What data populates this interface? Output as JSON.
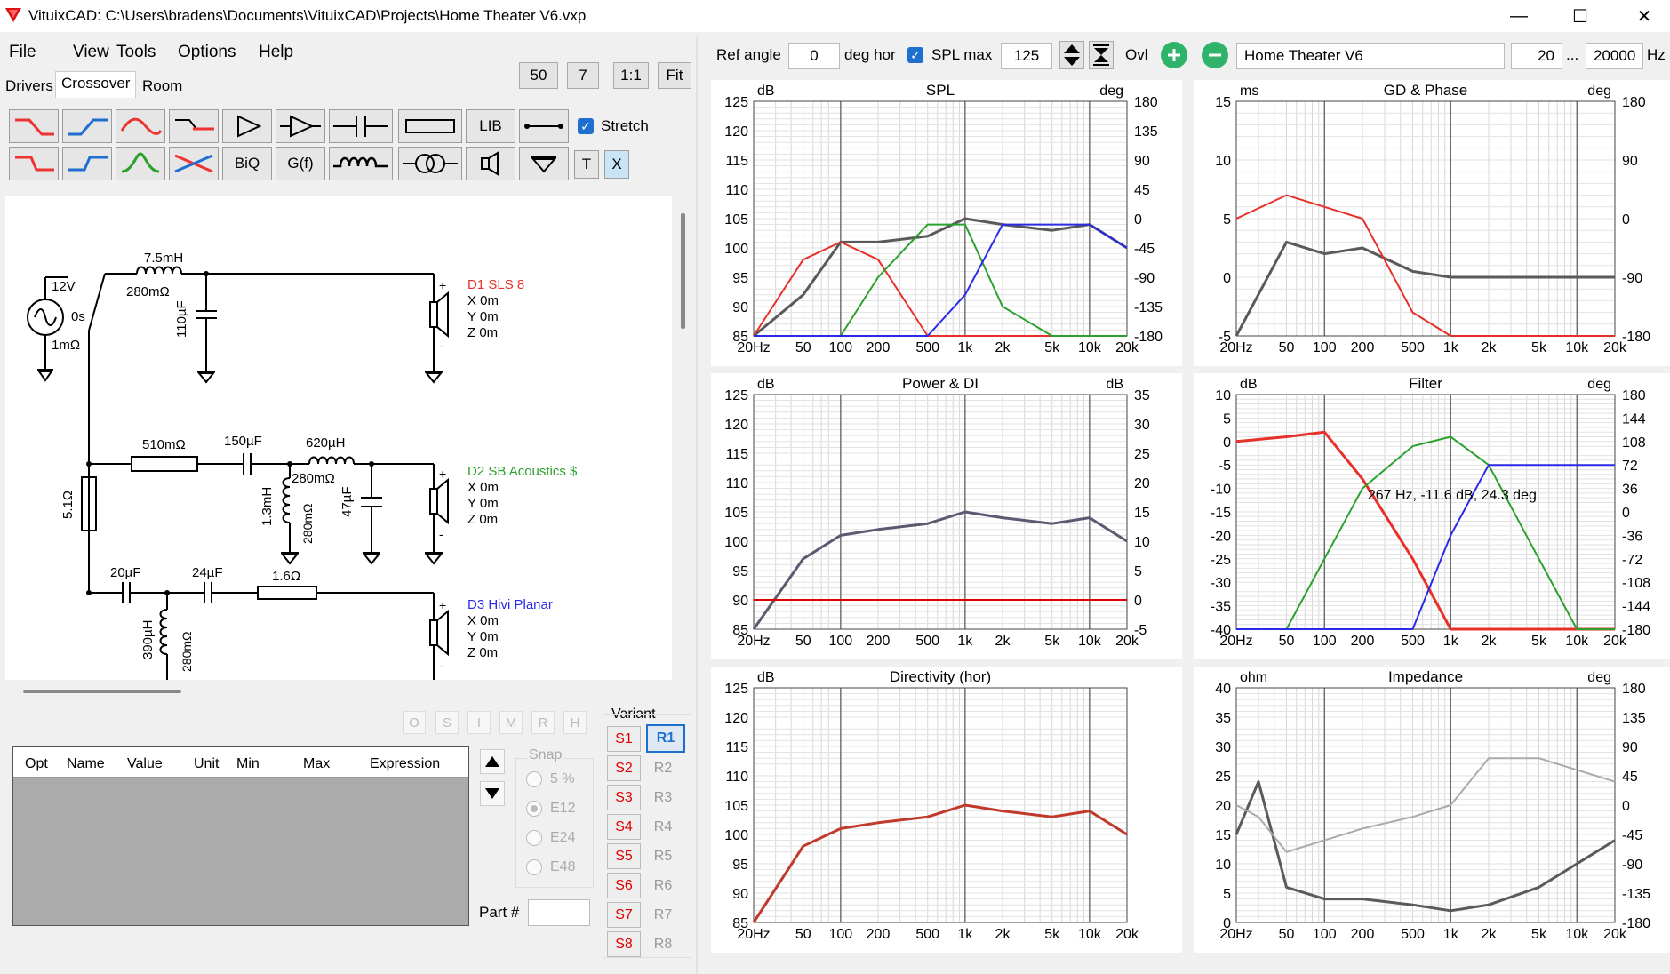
{
  "window": {
    "title": "VituixCAD: C:\\Users\\bradens\\Documents\\VituixCAD\\Projects\\Home Theater V6.vxp",
    "minimize": "—",
    "maximize": "☐",
    "close": "✕"
  },
  "menu": [
    "File",
    "View",
    "Tools",
    "Options",
    "Help"
  ],
  "tabs": [
    "Drivers",
    "Crossover",
    "Room"
  ],
  "zoom": {
    "b50": "50",
    "b7": "7",
    "b11": "1:1",
    "fit": "Fit"
  },
  "toolbar": {
    "lib": "LIB",
    "biq": "BiQ",
    "gf": "G(f)",
    "t": "T",
    "x": "X",
    "stretch": "Stretch"
  },
  "top": {
    "ref_angle_label": "Ref angle",
    "ref_angle": "0",
    "deg_hor": "deg hor",
    "spl_max_label": "SPL max",
    "spl_max": "125",
    "ovl": "Ovl",
    "name": "Home Theater V6",
    "f_lo": "20",
    "dots": "...",
    "f_hi": "20000",
    "hz": "Hz"
  },
  "schematic": {
    "source": {
      "v": "12V",
      "t": "0s",
      "r": "1mΩ"
    },
    "b1": {
      "l": "7.5mH",
      "lr": "280mΩ",
      "c": "110µF"
    },
    "d1": {
      "name": "D1 SLS 8",
      "x": "X 0m",
      "y": "Y 0m",
      "z": "Z 0m"
    },
    "b2": {
      "r": "510mΩ",
      "c": "150µF",
      "l": "620µH",
      "lr": "280mΩ",
      "sl": "1.3mH",
      "slr": "280mΩ",
      "sc": "47µF",
      "rs": "5.1Ω"
    },
    "d2": {
      "name": "D2 SB Acoustics $",
      "x": "X 0m",
      "y": "Y 0m",
      "z": "Z 0m"
    },
    "b3": {
      "c1": "20µF",
      "c2": "24µF",
      "r": "1.6Ω",
      "l": "390µH",
      "lr": "280mΩ"
    },
    "d3": {
      "name": "D3 Hivi Planar",
      "x": "X 0m",
      "y": "Y 0m",
      "z": "Z 0m"
    }
  },
  "opt_buttons": [
    "O",
    "S",
    "I",
    "M",
    "R",
    "H"
  ],
  "table": {
    "headers": [
      "Opt",
      "Name",
      "Value",
      "Unit",
      "Min",
      "Max",
      "Expression"
    ]
  },
  "snap": {
    "label": "Snap",
    "options": [
      "5 %",
      "E12",
      "E24",
      "E48"
    ],
    "selected": "E12"
  },
  "part": {
    "label": "Part #"
  },
  "variant": {
    "label": "Variant",
    "s": [
      "S1",
      "S2",
      "S3",
      "S4",
      "S5",
      "S6",
      "S7",
      "S8"
    ],
    "r": [
      "R1",
      "R2",
      "R3",
      "R4",
      "R5",
      "R6",
      "R7",
      "R8"
    ],
    "active": "R1"
  },
  "colors": {
    "d1": "#e8302a",
    "d2": "#2ca02c",
    "d3": "#2a2ae8",
    "total": "#5a5a5a",
    "power": "#5a5a70",
    "di": "#e00000",
    "directivity": "#c0392b"
  },
  "x_ticks": [
    "20Hz",
    "50",
    "100",
    "200",
    "500",
    "1k",
    "2k",
    "5k",
    "10k",
    "20k"
  ],
  "chart_data": [
    {
      "type": "line",
      "title": "SPL",
      "ylabel": "dB",
      "y2label": "deg",
      "ylim": [
        85,
        125
      ],
      "y2lim": [
        -180,
        180
      ],
      "yticks": [
        "125",
        "120",
        "115",
        "110",
        "105",
        "100",
        "95",
        "90",
        "85"
      ],
      "y2ticks": [
        "180",
        "135",
        "90",
        "45",
        "0",
        "-45",
        "-90",
        "-135",
        "-180"
      ],
      "x": [
        20,
        50,
        100,
        200,
        500,
        1000,
        2000,
        5000,
        10000,
        20000
      ],
      "series": [
        {
          "values": [
            85,
            92,
            101,
            101,
            102,
            105,
            104,
            103,
            104,
            100
          ]
        },
        {
          "values": [
            85,
            98,
            101,
            98,
            85,
            85,
            85,
            85,
            85,
            85
          ]
        },
        {
          "values": [
            85,
            85,
            85,
            95,
            104,
            104,
            90,
            85,
            85,
            85
          ]
        },
        {
          "values": [
            85,
            85,
            85,
            85,
            85,
            92,
            104,
            104,
            104,
            100
          ]
        }
      ]
    },
    {
      "type": "line",
      "title": "GD & Phase",
      "ylabel": "ms",
      "y2label": "deg",
      "ylim": [
        -5,
        15
      ],
      "y2lim": [
        -180,
        180
      ],
      "yticks": [
        "15",
        "10",
        "5",
        "0",
        "-5"
      ],
      "y2ticks": [
        "180",
        "90",
        "0",
        "-90",
        "-180"
      ],
      "x": [
        20,
        50,
        100,
        200,
        500,
        1000,
        2000,
        5000,
        10000,
        20000
      ],
      "series": [
        {
          "values": [
            -5,
            3,
            2,
            2.5,
            0.5,
            0,
            0,
            0,
            0,
            0
          ]
        },
        {
          "values": [
            5,
            7,
            6,
            5,
            -3,
            -5,
            -5,
            -5,
            -5,
            -5
          ]
        }
      ]
    },
    {
      "type": "line",
      "title": "Power & DI",
      "ylabel": "dB",
      "y2label": "dB",
      "ylim": [
        85,
        125
      ],
      "y2lim": [
        -5,
        35
      ],
      "yticks": [
        "125",
        "120",
        "115",
        "110",
        "105",
        "100",
        "95",
        "90",
        "85"
      ],
      "y2ticks": [
        "35",
        "30",
        "25",
        "20",
        "15",
        "10",
        "5",
        "0",
        "-5"
      ],
      "x": [
        20,
        50,
        100,
        200,
        500,
        1000,
        2000,
        5000,
        10000,
        20000
      ],
      "series": [
        {
          "values": [
            85,
            97,
            101,
            102,
            103,
            105,
            104,
            103,
            104,
            100
          ]
        },
        {
          "values": [
            90,
            90,
            90,
            90,
            90,
            90,
            90,
            90,
            90,
            90
          ]
        }
      ]
    },
    {
      "type": "line",
      "title": "Filter",
      "ylabel": "dB",
      "y2label": "deg",
      "ylim": [
        -40,
        10
      ],
      "y2lim": [
        -180,
        180
      ],
      "yticks": [
        "10",
        "5",
        "0",
        "-5",
        "-10",
        "-15",
        "-20",
        "-25",
        "-30",
        "-35",
        "-40"
      ],
      "y2ticks": [
        "180",
        "144",
        "108",
        "72",
        "36",
        "0",
        "-36",
        "-72",
        "-108",
        "-144",
        "-180"
      ],
      "annotation": "267 Hz, -11.6 dB, 24.3 deg",
      "x": [
        20,
        50,
        100,
        200,
        500,
        1000,
        2000,
        5000,
        10000,
        20000
      ],
      "series": [
        {
          "values": [
            0,
            1,
            2,
            -8,
            -25,
            -40,
            -40,
            -40,
            -40,
            -40
          ]
        },
        {
          "values": [
            -40,
            -40,
            -25,
            -10,
            -1,
            1,
            -5,
            -25,
            -40,
            -40
          ]
        },
        {
          "values": [
            -40,
            -40,
            -40,
            -40,
            -40,
            -20,
            -5,
            -5,
            -5,
            -5
          ]
        }
      ]
    },
    {
      "type": "line",
      "title": "Directivity (hor)",
      "ylabel": "dB",
      "ylim": [
        85,
        125
      ],
      "yticks": [
        "125",
        "120",
        "115",
        "110",
        "105",
        "100",
        "95",
        "90",
        "85"
      ],
      "x": [
        20,
        50,
        100,
        200,
        500,
        1000,
        2000,
        5000,
        10000,
        20000
      ],
      "series": [
        {
          "values": [
            85,
            98,
            101,
            102,
            103,
            105,
            104,
            103,
            104,
            100
          ]
        }
      ]
    },
    {
      "type": "line",
      "title": "Impedance",
      "ylabel": "ohm",
      "y2label": "deg",
      "ylim": [
        0,
        40
      ],
      "y2lim": [
        -180,
        180
      ],
      "yticks": [
        "40",
        "35",
        "30",
        "25",
        "20",
        "15",
        "10",
        "5",
        "0"
      ],
      "y2ticks": [
        "180",
        "135",
        "90",
        "45",
        "0",
        "-45",
        "-90",
        "-135",
        "-180"
      ],
      "x": [
        20,
        30,
        50,
        100,
        200,
        500,
        1000,
        2000,
        5000,
        10000,
        20000
      ],
      "series": [
        {
          "values": [
            15,
            24,
            6,
            4,
            4,
            3,
            2,
            3,
            6,
            10,
            14
          ]
        },
        {
          "values": [
            20,
            18,
            12,
            14,
            16,
            18,
            20,
            28,
            28,
            26,
            24
          ]
        }
      ]
    }
  ]
}
